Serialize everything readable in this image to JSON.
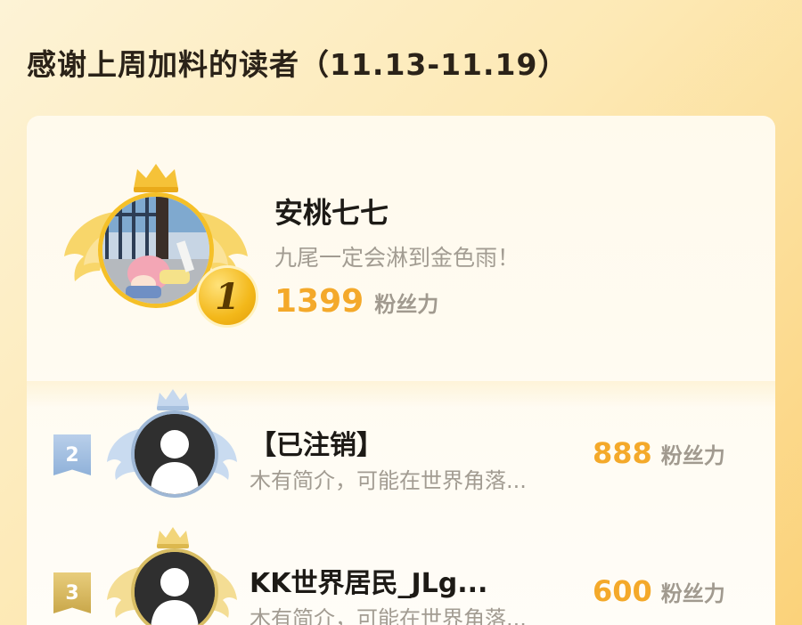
{
  "page": {
    "title": "感谢上周加料的读者（11.13-11.19）"
  },
  "colors": {
    "accent_gold": "#f4a92a",
    "silver": "#9eb7d5",
    "bronze_gold": "#d8bd63",
    "muted_text": "#a29c92"
  },
  "top_reader": {
    "rank": "1",
    "name": "安桃七七",
    "bio": "九尾一定会淋到金色雨！",
    "score": "1399",
    "score_unit": "粉丝力",
    "avatar_icon": "anime-girl-avatar"
  },
  "readers": [
    {
      "rank": "2",
      "name": "【已注销】",
      "bio": "木有简介，可能在世界角落...",
      "score": "888",
      "score_unit": "粉丝力",
      "avatar_icon": "default-user-avatar"
    },
    {
      "rank": "3",
      "name": "KK世界居民_JLg...",
      "bio": "木有简介，可能在世界角落...",
      "score": "600",
      "score_unit": "粉丝力",
      "avatar_icon": "default-user-avatar"
    }
  ]
}
